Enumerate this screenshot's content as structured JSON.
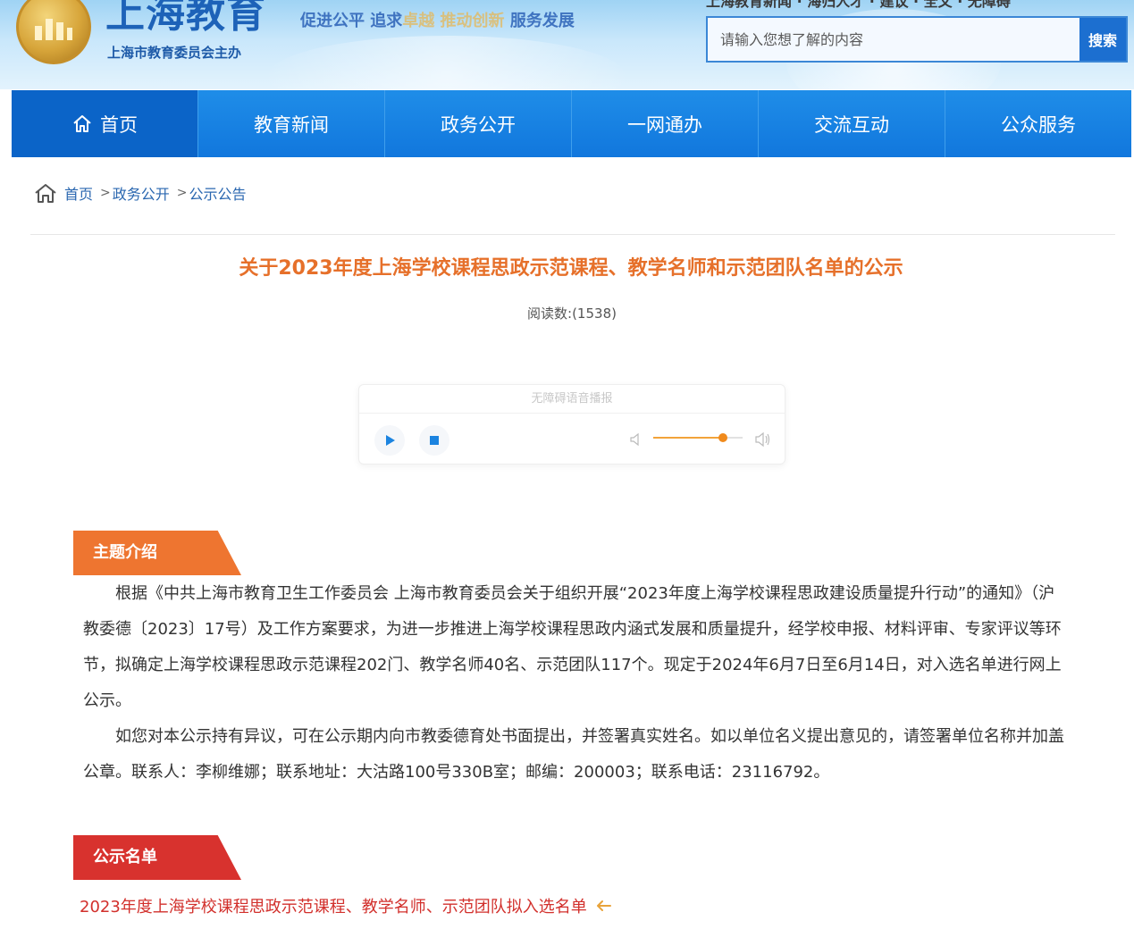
{
  "header": {
    "logo_title": "上海教育",
    "logo_subtitle": "上海市教育委员会主办",
    "slogan_a": "促进公平 追求",
    "slogan_faded": "卓越 推动创新",
    "slogan_b": " 服务发展",
    "top_links": "上海教育新闻 · 海归人才 · 建议 · 全文 · 无障碍",
    "search": {
      "placeholder": "请输入您想了解的内容",
      "button_label": "搜索"
    }
  },
  "nav": {
    "items": [
      {
        "label": "首页",
        "icon": "home-icon"
      },
      {
        "label": "教育新闻"
      },
      {
        "label": "政务公开"
      },
      {
        "label": "一网通办"
      },
      {
        "label": "交流互动"
      },
      {
        "label": "公众服务"
      }
    ]
  },
  "breadcrumb": {
    "items": [
      "首页",
      "政务公开",
      "公示公告"
    ],
    "separator": ">"
  },
  "article": {
    "title": "关于2023年度上海学校课程思政示范课程、教学名师和示范团队名单的公示",
    "read_label": "阅读数:(1538)"
  },
  "player": {
    "title": "无障碍语音播报",
    "volume": 0.78
  },
  "sections": {
    "intro_tag": "主题介绍",
    "list_tag": "公示名单"
  },
  "content": {
    "paragraphs": [
      "根据《中共上海市教育卫生工作委员会 上海市教育委员会关于组织开展“2023年度上海学校课程思政建设质量提升行动”的通知》（沪教委德〔2023〕17号）及工作方案要求，为进一步推进上海学校课程思政内涵式发展和质量提升，经学校申报、材料评审、专家评议等环节，拟确定上海学校课程思政示范课程202门、教学名师40名、示范团队117个。现定于2024年6月7日至6月14日，对入选名单进行网上公示。",
      "如您对本公示持有异议，可在公示期内向市教委德育处书面提出，并签署真实姓名。如以单位名义提出意见的，请签署单位名称并加盖公章。联系人：李柳维娜；联系地址：大沽路100号330B室；邮编：200003；联系电话：23116792。"
    ]
  },
  "attachment": {
    "label": "2023年度上海学校课程思政示范课程、教学名师、示范团队拟入选名单",
    "icon": "attachment-arrow-icon"
  },
  "colors": {
    "nav_blue": "#1177dd",
    "title_orange": "#e6702a",
    "tag_orange": "#ee7530",
    "tag_red": "#d8322e",
    "link_red": "#d2302c"
  }
}
